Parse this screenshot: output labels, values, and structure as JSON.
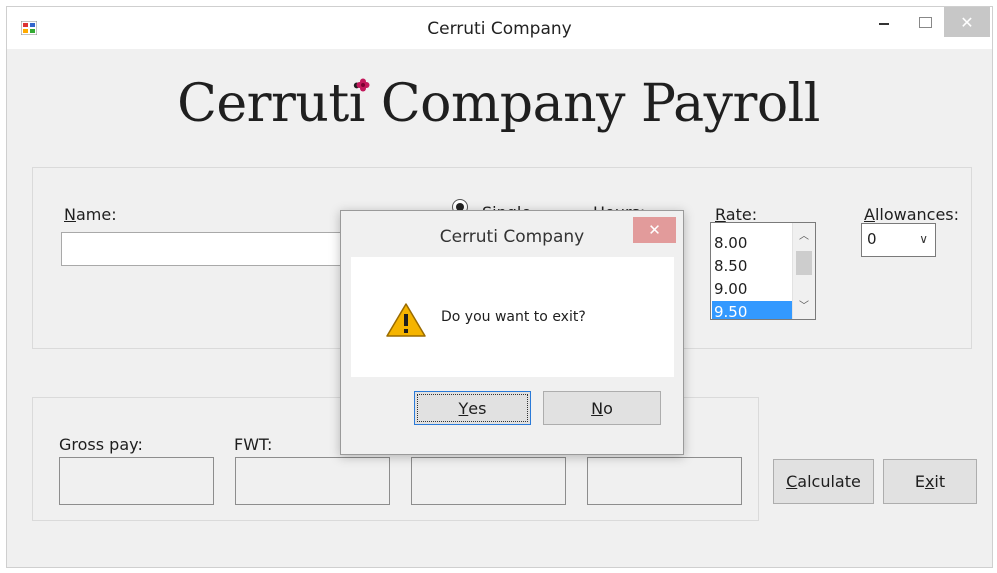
{
  "window": {
    "title": "Cerruti Company",
    "close_glyph": "✕"
  },
  "heading": "Cerruti Company Payroll",
  "form": {
    "name_label_key": "N",
    "name_label_rest": "ame:",
    "name_value": "",
    "status_option": "Single",
    "hours_label": "Hours:",
    "rate_label_key": "R",
    "rate_label_rest": "ate:",
    "rate_options": [
      "8.00",
      "8.50",
      "9.00",
      "9.50"
    ],
    "rate_selected": "9.50",
    "allowances_label_key": "A",
    "allowances_label_rest": "llowances:",
    "allowances_value": "0"
  },
  "results": {
    "gross_pay_label": "Gross pay:",
    "fwt_label": "FWT:",
    "gross_pay_value": "",
    "fwt_value": "",
    "field3_value": "",
    "field4_value": ""
  },
  "buttons": {
    "calculate_key": "C",
    "calculate_rest": "alculate",
    "exit_pre": "E",
    "exit_key": "x",
    "exit_post": "it"
  },
  "dialog": {
    "title": "Cerruti Company",
    "close_glyph": "✕",
    "message": "Do you want to exit?",
    "yes_key": "Y",
    "yes_rest": "es",
    "no_key": "N",
    "no_rest": "o"
  },
  "icons": {
    "app": "app-icon",
    "warning": "warning-icon",
    "flower": "flower-icon"
  },
  "colors": {
    "selection": "#3399ff",
    "dialog_close": "#e29b9b",
    "focus_border": "#2a7ad8"
  }
}
